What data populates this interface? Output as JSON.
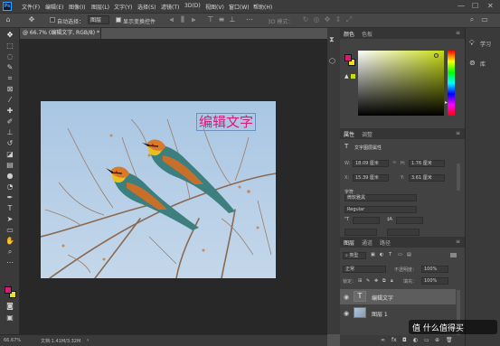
{
  "app": {
    "logo_text": "Ps"
  },
  "menu": [
    "文件(F)",
    "编辑(E)",
    "图像(I)",
    "图层(L)",
    "文字(Y)",
    "选择(S)",
    "滤镜(T)",
    "3D(D)",
    "视图(V)",
    "窗口(W)",
    "帮助(H)"
  ],
  "window_buttons": {
    "minimize": "—",
    "maximize": "☐",
    "close": "✕"
  },
  "options": {
    "auto_select_label": "自动选择：",
    "auto_select_value": "图层",
    "transform_label": "显示变换控件",
    "mode_3d_label": "3D 模式："
  },
  "document": {
    "tab_title": "@ 66.7% (编辑文字, RGB/8) *",
    "close_glyph": "×",
    "overlay_text": "编辑文字",
    "overlay_color": "#d81b78"
  },
  "status": {
    "zoom": "66.67%",
    "doc_info": "文档:1.41M/3.32M"
  },
  "colors": {
    "foreground": "#d81b78",
    "background": "#e8e020",
    "picker_hue": "#c8dc14"
  },
  "color_panel": {
    "tabs": [
      "颜色",
      "色板"
    ]
  },
  "properties_panel": {
    "tabs": [
      "属性",
      "调整"
    ],
    "layer_type": "文字图层属性",
    "w_label": "W:",
    "w_value": "18.09 厘米",
    "h_label": "H:",
    "h_value": "1.76 厘米",
    "x_label": "X:",
    "x_value": "15.39 厘米",
    "y_label": "Y:",
    "y_value": "3.61 厘米",
    "section_label": "字符",
    "font_family": "微软雅黑",
    "font_style": "Regular"
  },
  "layers_panel": {
    "tabs": [
      "图层",
      "通道",
      "路径"
    ],
    "kind_filter": "类型",
    "blend_mode": "正常",
    "opacity_label": "不透明度：",
    "opacity_value": "100%",
    "lock_label": "锁定：",
    "fill_label": "填充：",
    "fill_value": "100%",
    "layers": [
      {
        "name": "编辑文字",
        "type": "text",
        "selected": true
      },
      {
        "name": "图层 1",
        "type": "image",
        "selected": false
      }
    ]
  },
  "right_dock": {
    "learn_label": "学习",
    "libraries_label": "库"
  },
  "watermark": "值 什么值得买"
}
